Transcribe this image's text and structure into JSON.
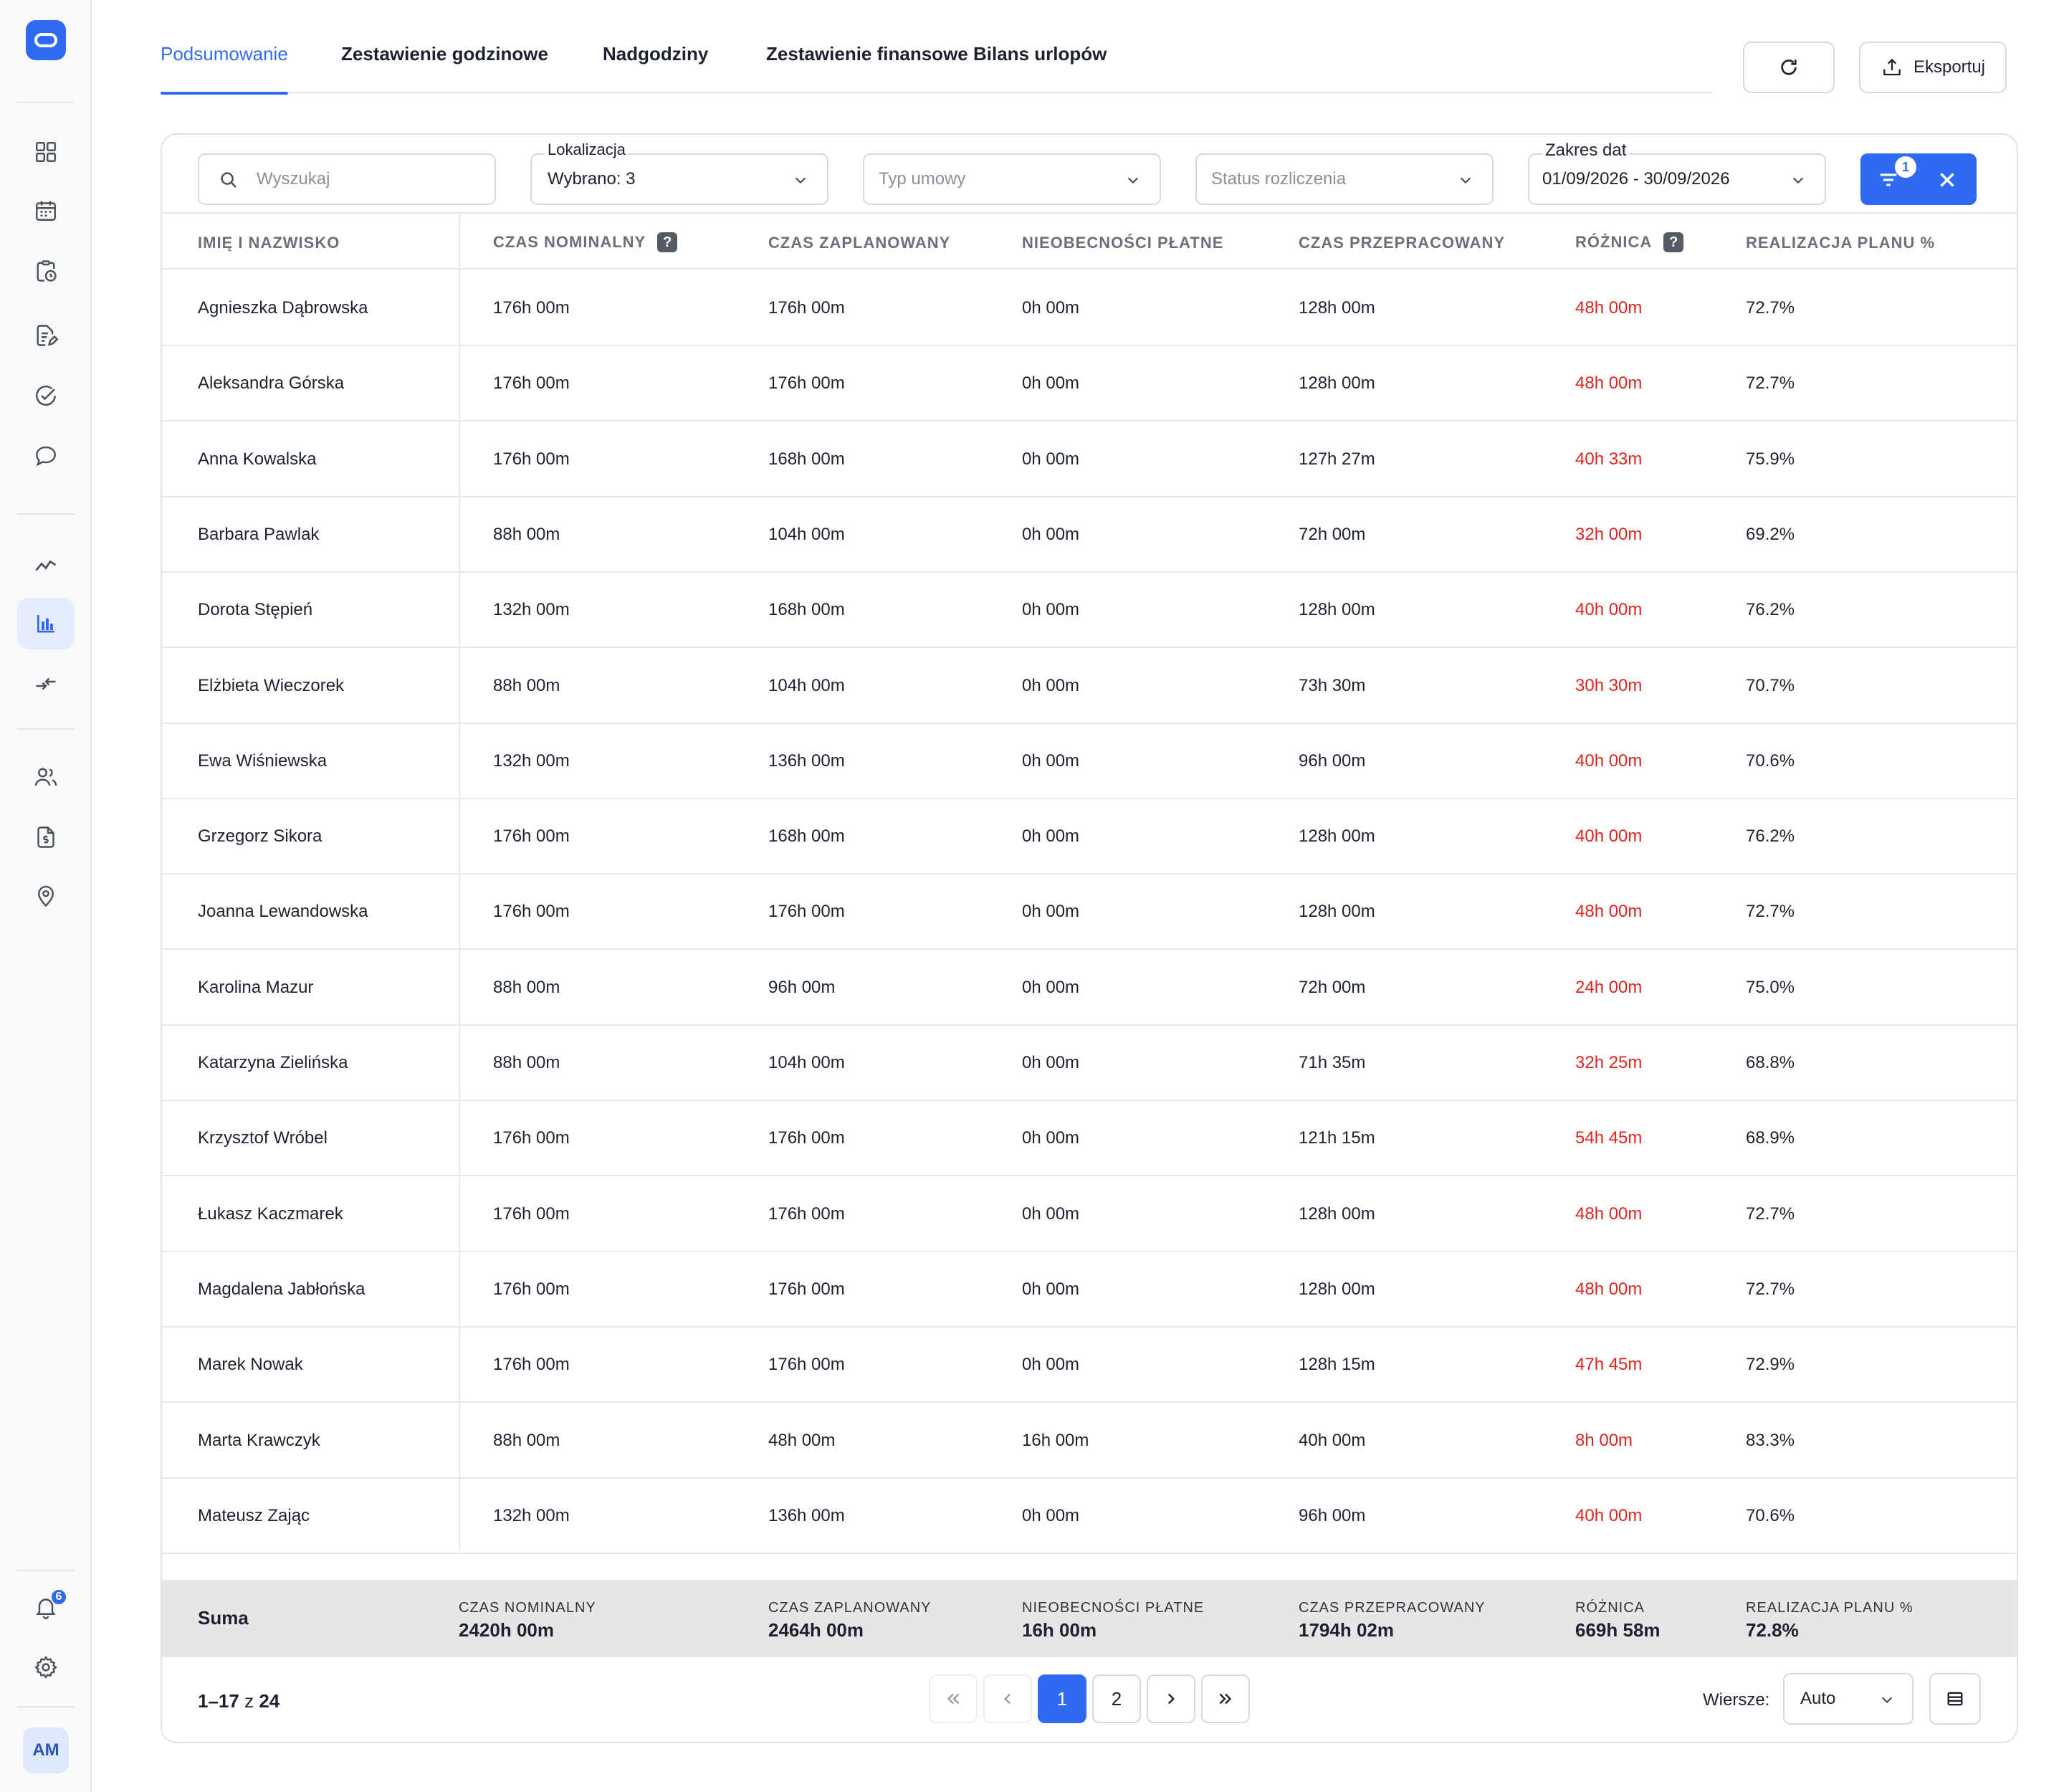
{
  "nav": {
    "tabs": [
      {
        "label": "Podsumowanie",
        "active": true
      },
      {
        "label": "Zestawienie godzinowe"
      },
      {
        "label": "Nadgodziny"
      },
      {
        "label": "Zestawienie finansowe"
      },
      {
        "label": "Bilans urlopów"
      }
    ],
    "refresh_icon": "refresh-icon",
    "export_label": "Eksportuj"
  },
  "sidebar": {
    "icons": [
      "dashboard-grid-icon",
      "calendar-icon",
      "clipboard-clock-icon",
      "document-edit-icon",
      "check-circle-icon",
      "chat-bubble-icon",
      "trend-line-icon",
      "bar-chart-icon",
      "transfer-arrows-icon",
      "users-icon",
      "document-money-icon",
      "location-pin-icon",
      "bell-icon",
      "settings-gear-icon"
    ],
    "notifications_badge": "6",
    "avatar_initials": "AM",
    "accent": "#2f6bf2"
  },
  "filters": {
    "search_placeholder": "Wyszukaj",
    "location_label": "Lokalizacja",
    "location_value": "Wybrano: 3",
    "contract_placeholder": "Typ umowy",
    "status_placeholder": "Status rozliczenia",
    "date_label": "Zakres dat",
    "date_value": "01/09/2026 - 30/09/2026",
    "active_filter_count": "1"
  },
  "table": {
    "headers": {
      "name": "IMIĘ I NAZWISKO",
      "nominal": "CZAS NOMINALNY",
      "planned": "CZAS ZAPLANOWANY",
      "absence": "NIEOBECNOŚCI PŁATNE",
      "worked": "CZAS PRZEPRACOWANY",
      "diff": "RÓŻNICA",
      "plan_pct": "REALIZACJA PLANU %"
    },
    "help_mark": "?",
    "rows": [
      {
        "name": "Agnieszka Dąbrowska",
        "nominal": "176h 00m",
        "planned": "176h 00m",
        "absence": "0h 00m",
        "worked": "128h 00m",
        "diff": "48h 00m",
        "plan_pct": "72.7%"
      },
      {
        "name": "Aleksandra Górska",
        "nominal": "176h 00m",
        "planned": "176h 00m",
        "absence": "0h 00m",
        "worked": "128h 00m",
        "diff": "48h 00m",
        "plan_pct": "72.7%"
      },
      {
        "name": "Anna Kowalska",
        "nominal": "176h 00m",
        "planned": "168h 00m",
        "absence": "0h 00m",
        "worked": "127h 27m",
        "diff": "40h 33m",
        "plan_pct": "75.9%"
      },
      {
        "name": "Barbara Pawlak",
        "nominal": "88h 00m",
        "planned": "104h 00m",
        "absence": "0h 00m",
        "worked": "72h 00m",
        "diff": "32h 00m",
        "plan_pct": "69.2%"
      },
      {
        "name": "Dorota Stępień",
        "nominal": "132h 00m",
        "planned": "168h 00m",
        "absence": "0h 00m",
        "worked": "128h 00m",
        "diff": "40h 00m",
        "plan_pct": "76.2%"
      },
      {
        "name": "Elżbieta Wieczorek",
        "nominal": "88h 00m",
        "planned": "104h 00m",
        "absence": "0h 00m",
        "worked": "73h 30m",
        "diff": "30h 30m",
        "plan_pct": "70.7%"
      },
      {
        "name": "Ewa Wiśniewska",
        "nominal": "132h 00m",
        "planned": "136h 00m",
        "absence": "0h 00m",
        "worked": "96h 00m",
        "diff": "40h 00m",
        "plan_pct": "70.6%"
      },
      {
        "name": "Grzegorz Sikora",
        "nominal": "176h 00m",
        "planned": "168h 00m",
        "absence": "0h 00m",
        "worked": "128h 00m",
        "diff": "40h 00m",
        "plan_pct": "76.2%"
      },
      {
        "name": "Joanna Lewandowska",
        "nominal": "176h 00m",
        "planned": "176h 00m",
        "absence": "0h 00m",
        "worked": "128h 00m",
        "diff": "48h 00m",
        "plan_pct": "72.7%"
      },
      {
        "name": "Karolina Mazur",
        "nominal": "88h 00m",
        "planned": "96h 00m",
        "absence": "0h 00m",
        "worked": "72h 00m",
        "diff": "24h 00m",
        "plan_pct": "75.0%"
      },
      {
        "name": "Katarzyna Zielińska",
        "nominal": "88h 00m",
        "planned": "104h 00m",
        "absence": "0h 00m",
        "worked": "71h 35m",
        "diff": "32h 25m",
        "plan_pct": "68.8%"
      },
      {
        "name": "Krzysztof Wróbel",
        "nominal": "176h 00m",
        "planned": "176h 00m",
        "absence": "0h 00m",
        "worked": "121h 15m",
        "diff": "54h 45m",
        "plan_pct": "68.9%"
      },
      {
        "name": "Łukasz Kaczmarek",
        "nominal": "176h 00m",
        "planned": "176h 00m",
        "absence": "0h 00m",
        "worked": "128h 00m",
        "diff": "48h 00m",
        "plan_pct": "72.7%"
      },
      {
        "name": "Magdalena Jabłońska",
        "nominal": "176h 00m",
        "planned": "176h 00m",
        "absence": "0h 00m",
        "worked": "128h 00m",
        "diff": "48h 00m",
        "plan_pct": "72.7%"
      },
      {
        "name": "Marek Nowak",
        "nominal": "176h 00m",
        "planned": "176h 00m",
        "absence": "0h 00m",
        "worked": "128h 15m",
        "diff": "47h 45m",
        "plan_pct": "72.9%"
      },
      {
        "name": "Marta Krawczyk",
        "nominal": "88h 00m",
        "planned": "48h 00m",
        "absence": "16h 00m",
        "worked": "40h 00m",
        "diff": "8h 00m",
        "plan_pct": "83.3%"
      },
      {
        "name": "Mateusz Zając",
        "nominal": "132h 00m",
        "planned": "136h 00m",
        "absence": "0h 00m",
        "worked": "96h 00m",
        "diff": "40h 00m",
        "plan_pct": "70.6%"
      }
    ],
    "negative_color": "#e0241d"
  },
  "summary": {
    "title": "Suma",
    "nominal_label": "CZAS NOMINALNY",
    "nominal": "2420h 00m",
    "planned_label": "CZAS ZAPLANOWANY",
    "planned": "2464h 00m",
    "absence_label": "NIEOBECNOŚCI PŁATNE",
    "absence": "16h 00m",
    "worked_label": "CZAS PRZEPRACOWANY",
    "worked": "1794h 02m",
    "diff_label": "RÓŻNICA",
    "diff": "669h 58m",
    "plan_label": "REALIZACJA PLANU %",
    "plan_pct": "72.8%"
  },
  "pagination": {
    "range": "1–17",
    "of": "z",
    "total": "24",
    "pages": [
      "1",
      "2"
    ],
    "current": "1",
    "rows_label": "Wiersze:",
    "rows_value": "Auto"
  }
}
